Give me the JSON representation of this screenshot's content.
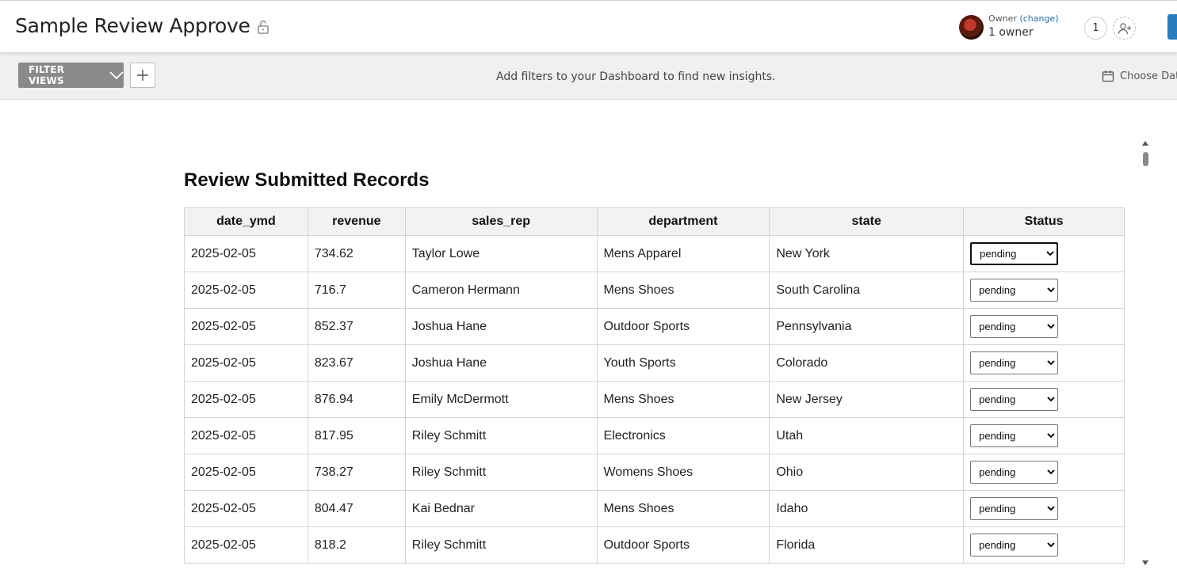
{
  "header": {
    "title": "Sample Review Approve",
    "lock_icon": "unlock-icon",
    "owner_label": "Owner",
    "owner_change": "(change)",
    "owner_count": "1 owner",
    "share_count": "1",
    "add_user_icon": "add-user-icon",
    "accent_color": "#2b7bc0"
  },
  "filterbar": {
    "filter_views_label": "FILTER VIEWS",
    "hint": "Add filters to your Dashboard to find new insights.",
    "date_label": "Choose Dat"
  },
  "report": {
    "title": "Review Submitted Records",
    "columns": [
      "date_ymd",
      "revenue",
      "sales_rep",
      "department",
      "state",
      "Status"
    ],
    "rows": [
      {
        "date_ymd": "2025-02-05",
        "revenue": "734.62",
        "sales_rep": "Taylor Lowe",
        "department": "Mens Apparel",
        "state": "New York",
        "status": "pending"
      },
      {
        "date_ymd": "2025-02-05",
        "revenue": "716.7",
        "sales_rep": "Cameron Hermann",
        "department": "Mens Shoes",
        "state": "South Carolina",
        "status": "pending"
      },
      {
        "date_ymd": "2025-02-05",
        "revenue": "852.37",
        "sales_rep": "Joshua Hane",
        "department": "Outdoor Sports",
        "state": "Pennsylvania",
        "status": "pending"
      },
      {
        "date_ymd": "2025-02-05",
        "revenue": "823.67",
        "sales_rep": "Joshua Hane",
        "department": "Youth Sports",
        "state": "Colorado",
        "status": "pending"
      },
      {
        "date_ymd": "2025-02-05",
        "revenue": "876.94",
        "sales_rep": "Emily McDermott",
        "department": "Mens Shoes",
        "state": "New Jersey",
        "status": "pending"
      },
      {
        "date_ymd": "2025-02-05",
        "revenue": "817.95",
        "sales_rep": "Riley Schmitt",
        "department": "Electronics",
        "state": "Utah",
        "status": "pending"
      },
      {
        "date_ymd": "2025-02-05",
        "revenue": "738.27",
        "sales_rep": "Riley Schmitt",
        "department": "Womens Shoes",
        "state": "Ohio",
        "status": "pending"
      },
      {
        "date_ymd": "2025-02-05",
        "revenue": "804.47",
        "sales_rep": "Kai Bednar",
        "department": "Mens Shoes",
        "state": "Idaho",
        "status": "pending"
      },
      {
        "date_ymd": "2025-02-05",
        "revenue": "818.2",
        "sales_rep": "Riley Schmitt",
        "department": "Outdoor Sports",
        "state": "Florida",
        "status": "pending"
      }
    ]
  }
}
